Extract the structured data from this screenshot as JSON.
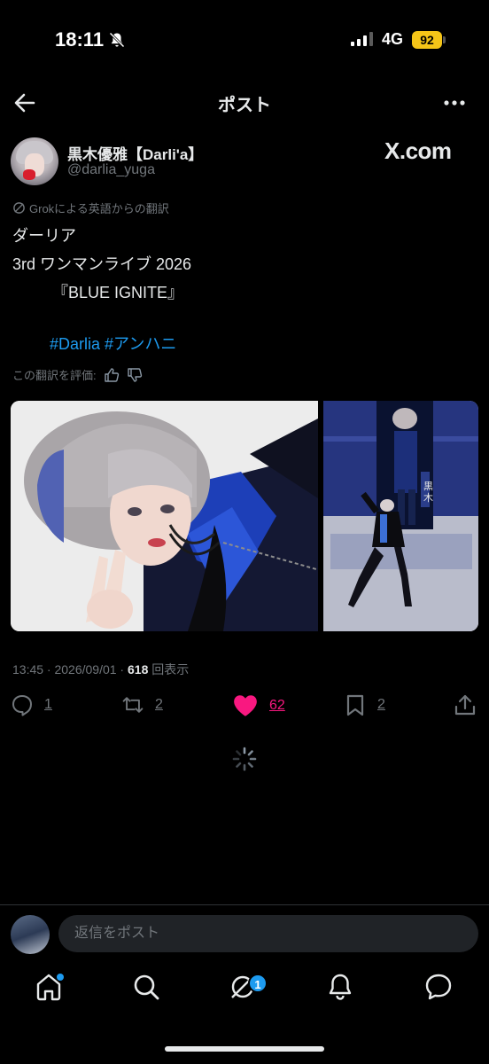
{
  "status_bar": {
    "time": "18:11",
    "network": "4G",
    "battery": "92",
    "icons": [
      "bell-slash-icon",
      "signal-icon",
      "battery-icon"
    ]
  },
  "header": {
    "title": "ポスト",
    "icons": [
      "back-arrow-icon",
      "more-icon"
    ]
  },
  "author": {
    "display_name": "黒木優雅【Darli'a】",
    "handle": "@darlia_yuga",
    "watermark": "X.com"
  },
  "post": {
    "translation_note": "Grokによる英語からの翻訳",
    "lines": [
      "ダーリア",
      "3rd ワンマンライブ 2026",
      "　　　『BLUE IGNITE』",
      ""
    ],
    "hashtags": "#Darlia #アンハニ",
    "rate_label": "この翻訳を評価:",
    "timestamp": "13:45 · 2026/09/01 · ",
    "views_count": "618",
    "views_label": "回表示"
  },
  "actions": {
    "replies": "1",
    "reposts": "2",
    "likes": "62",
    "bookmarks": "2"
  },
  "reply_bar": {
    "placeholder": "返信をポスト"
  },
  "bottom_nav": {
    "items": [
      "home-icon",
      "search-icon",
      "grok-icon",
      "notifications-icon",
      "messages-icon"
    ],
    "grok_badge": "1"
  },
  "colors": {
    "accent": "#1d9bf0",
    "like": "#f91880",
    "muted": "#71767b",
    "text": "#e7e9ea",
    "background": "#000000"
  }
}
